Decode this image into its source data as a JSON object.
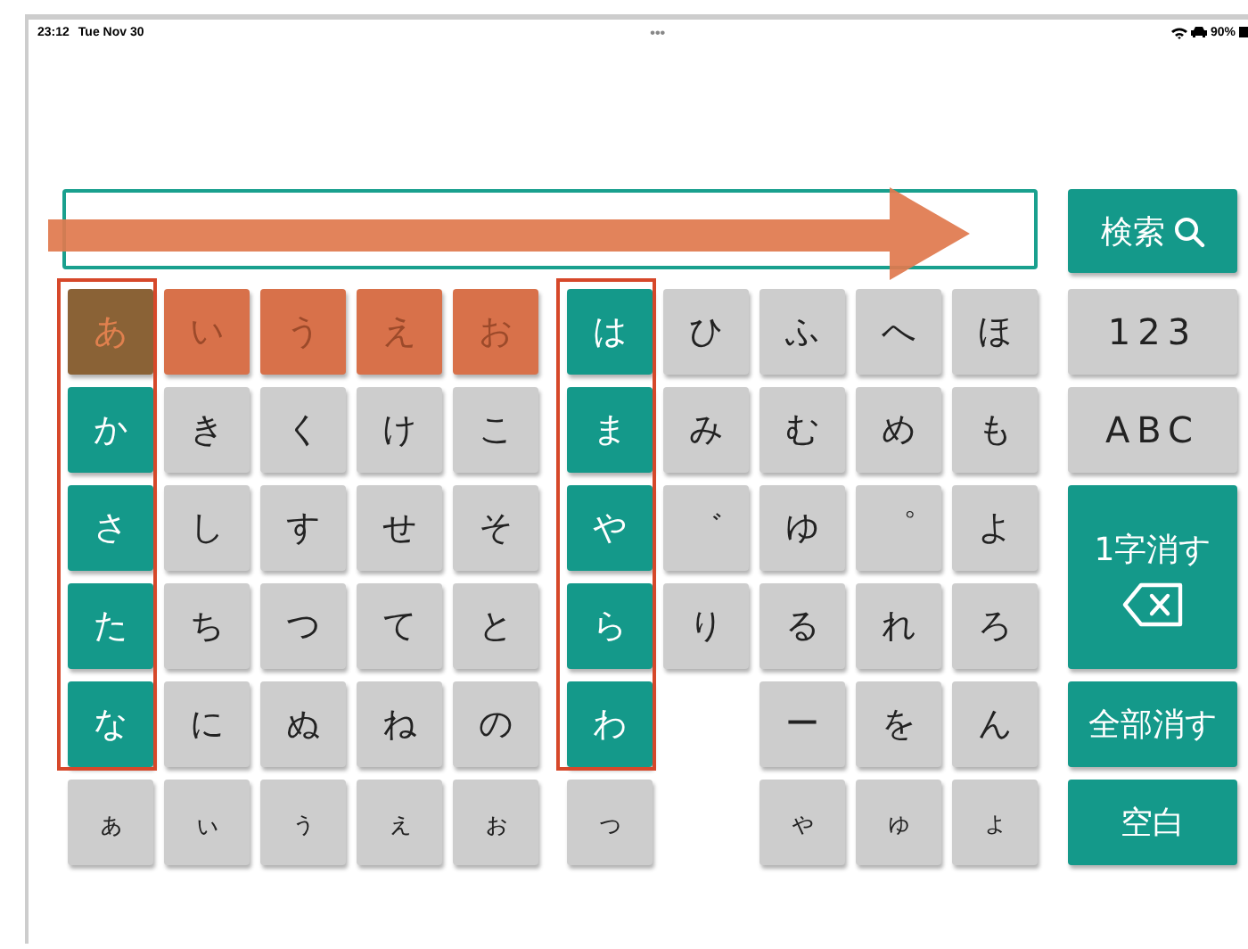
{
  "status_bar": {
    "time": "23:12",
    "date": "Tue Nov 30",
    "dots": "•••",
    "battery": "90%"
  },
  "search": {
    "button": "検索"
  },
  "keys": [
    [
      {
        "label": "あ",
        "kind": "active",
        "framed": true
      },
      {
        "label": "い",
        "kind": "orange"
      },
      {
        "label": "う",
        "kind": "orange"
      },
      {
        "label": "え",
        "kind": "orange"
      },
      {
        "label": "お",
        "kind": "orange"
      },
      {
        "label": "は",
        "kind": "teal",
        "framed": true
      },
      {
        "label": "ひ",
        "kind": "gray"
      },
      {
        "label": "ふ",
        "kind": "gray"
      },
      {
        "label": "へ",
        "kind": "gray"
      },
      {
        "label": "ほ",
        "kind": "gray"
      }
    ],
    [
      {
        "label": "か",
        "kind": "teal",
        "framed": true
      },
      {
        "label": "き",
        "kind": "gray"
      },
      {
        "label": "く",
        "kind": "gray"
      },
      {
        "label": "け",
        "kind": "gray"
      },
      {
        "label": "こ",
        "kind": "gray"
      },
      {
        "label": "ま",
        "kind": "teal",
        "framed": true
      },
      {
        "label": "み",
        "kind": "gray"
      },
      {
        "label": "む",
        "kind": "gray"
      },
      {
        "label": "め",
        "kind": "gray"
      },
      {
        "label": "も",
        "kind": "gray"
      }
    ],
    [
      {
        "label": "さ",
        "kind": "teal",
        "framed": true
      },
      {
        "label": "し",
        "kind": "gray"
      },
      {
        "label": "す",
        "kind": "gray"
      },
      {
        "label": "せ",
        "kind": "gray"
      },
      {
        "label": "そ",
        "kind": "gray"
      },
      {
        "label": "や",
        "kind": "teal",
        "framed": true
      },
      {
        "label": "゛",
        "kind": "gray"
      },
      {
        "label": "ゆ",
        "kind": "gray"
      },
      {
        "label": "゜",
        "kind": "gray"
      },
      {
        "label": "よ",
        "kind": "gray"
      }
    ],
    [
      {
        "label": "た",
        "kind": "teal",
        "framed": true
      },
      {
        "label": "ち",
        "kind": "gray"
      },
      {
        "label": "つ",
        "kind": "gray"
      },
      {
        "label": "て",
        "kind": "gray"
      },
      {
        "label": "と",
        "kind": "gray"
      },
      {
        "label": "ら",
        "kind": "teal",
        "framed": true
      },
      {
        "label": "り",
        "kind": "gray"
      },
      {
        "label": "る",
        "kind": "gray"
      },
      {
        "label": "れ",
        "kind": "gray"
      },
      {
        "label": "ろ",
        "kind": "gray"
      }
    ],
    [
      {
        "label": "な",
        "kind": "teal",
        "framed": true
      },
      {
        "label": "に",
        "kind": "gray"
      },
      {
        "label": "ぬ",
        "kind": "gray"
      },
      {
        "label": "ね",
        "kind": "gray"
      },
      {
        "label": "の",
        "kind": "gray"
      },
      {
        "label": "わ",
        "kind": "teal",
        "framed": true
      },
      {
        "kind": "gap"
      },
      {
        "label": "ー",
        "kind": "gray"
      },
      {
        "label": "を",
        "kind": "gray"
      },
      {
        "label": "ん",
        "kind": "gray"
      }
    ],
    [
      {
        "label": "ぁ",
        "kind": "small"
      },
      {
        "label": "ぃ",
        "kind": "small"
      },
      {
        "label": "ぅ",
        "kind": "small"
      },
      {
        "label": "ぇ",
        "kind": "small"
      },
      {
        "label": "ぉ",
        "kind": "small"
      },
      {
        "label": "っ",
        "kind": "small"
      },
      {
        "kind": "gap"
      },
      {
        "label": "ゃ",
        "kind": "small"
      },
      {
        "label": "ゅ",
        "kind": "small"
      },
      {
        "label": "ょ",
        "kind": "small"
      }
    ]
  ],
  "side_buttons": [
    {
      "label": "123",
      "kind": "gray"
    },
    {
      "label": "ABC",
      "kind": "gray"
    },
    {
      "label": "1字消す",
      "kind": "backspace"
    },
    {
      "label": "全部消す",
      "kind": "teal"
    },
    {
      "label": "空白",
      "kind": "teal"
    }
  ],
  "annotations": [
    {
      "kind": "arrow"
    }
  ]
}
